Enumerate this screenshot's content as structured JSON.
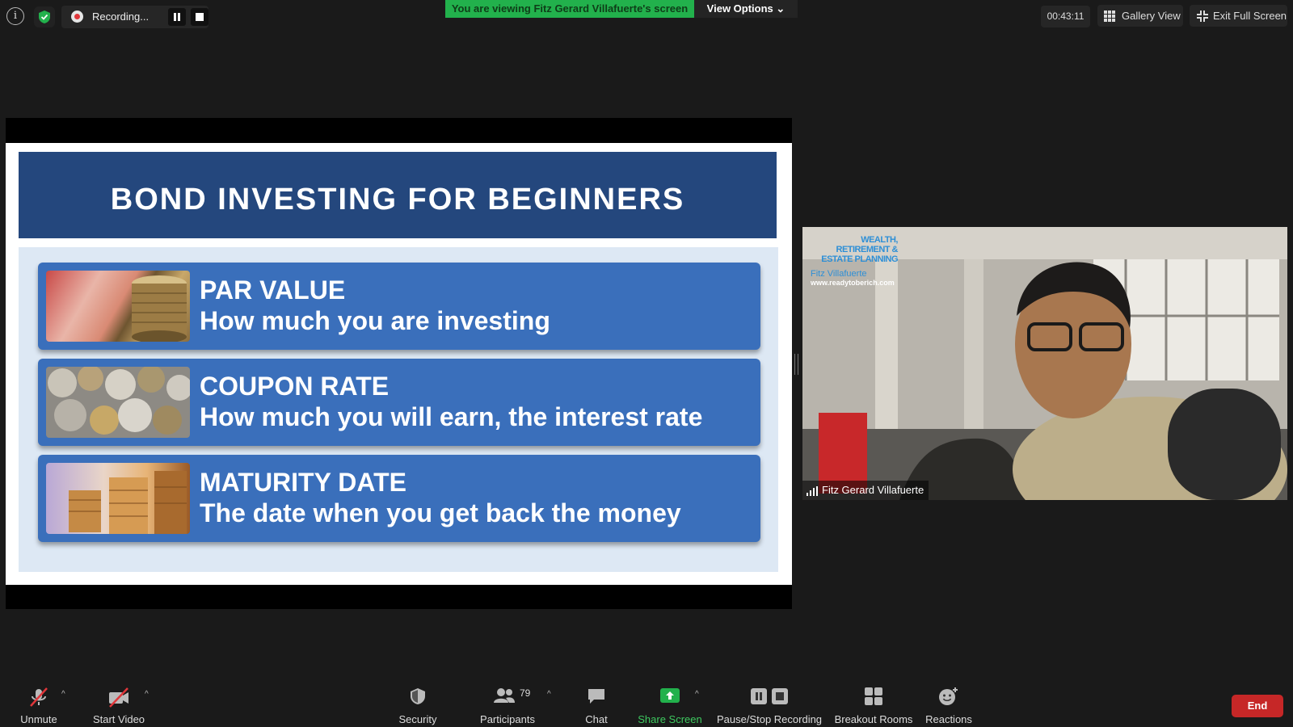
{
  "topbar": {
    "recording_label": "Recording...",
    "viewing_banner": "You are viewing Fitz Gerard Villafuerte's screen",
    "view_options": "View Options",
    "timer": "00:43:11",
    "gallery_view": "Gallery View",
    "exit_full_screen": "Exit Full Screen"
  },
  "slide": {
    "title": "BOND INVESTING FOR BEGINNERS",
    "cards": [
      {
        "heading": "PAR VALUE",
        "description": "How much you are investing"
      },
      {
        "heading": "COUPON RATE",
        "description": "How much you will earn, the interest rate"
      },
      {
        "heading": "MATURITY DATE",
        "description": "The date when you get back the money"
      }
    ]
  },
  "camera": {
    "logo_line1": "WEALTH,",
    "logo_line2": "RETIREMENT &",
    "logo_line3": "ESTATE PLANNING",
    "logo_name": "Fitz Villafuerte",
    "logo_url": "www.readytoberich.com",
    "participant_name": "Fitz Gerard Villafuerte"
  },
  "toolbar": {
    "unmute": "Unmute",
    "start_video": "Start Video",
    "security": "Security",
    "participants": "Participants",
    "participants_count": "79",
    "chat": "Chat",
    "share_screen": "Share Screen",
    "pause_stop_recording": "Pause/Stop Recording",
    "breakout_rooms": "Breakout Rooms",
    "reactions": "Reactions",
    "end": "End"
  },
  "colors": {
    "banner_green": "#22b14c",
    "slide_header": "#24477d",
    "card_blue": "#3a6fbb",
    "share_green": "#22b14c",
    "end_red": "#c62727"
  }
}
